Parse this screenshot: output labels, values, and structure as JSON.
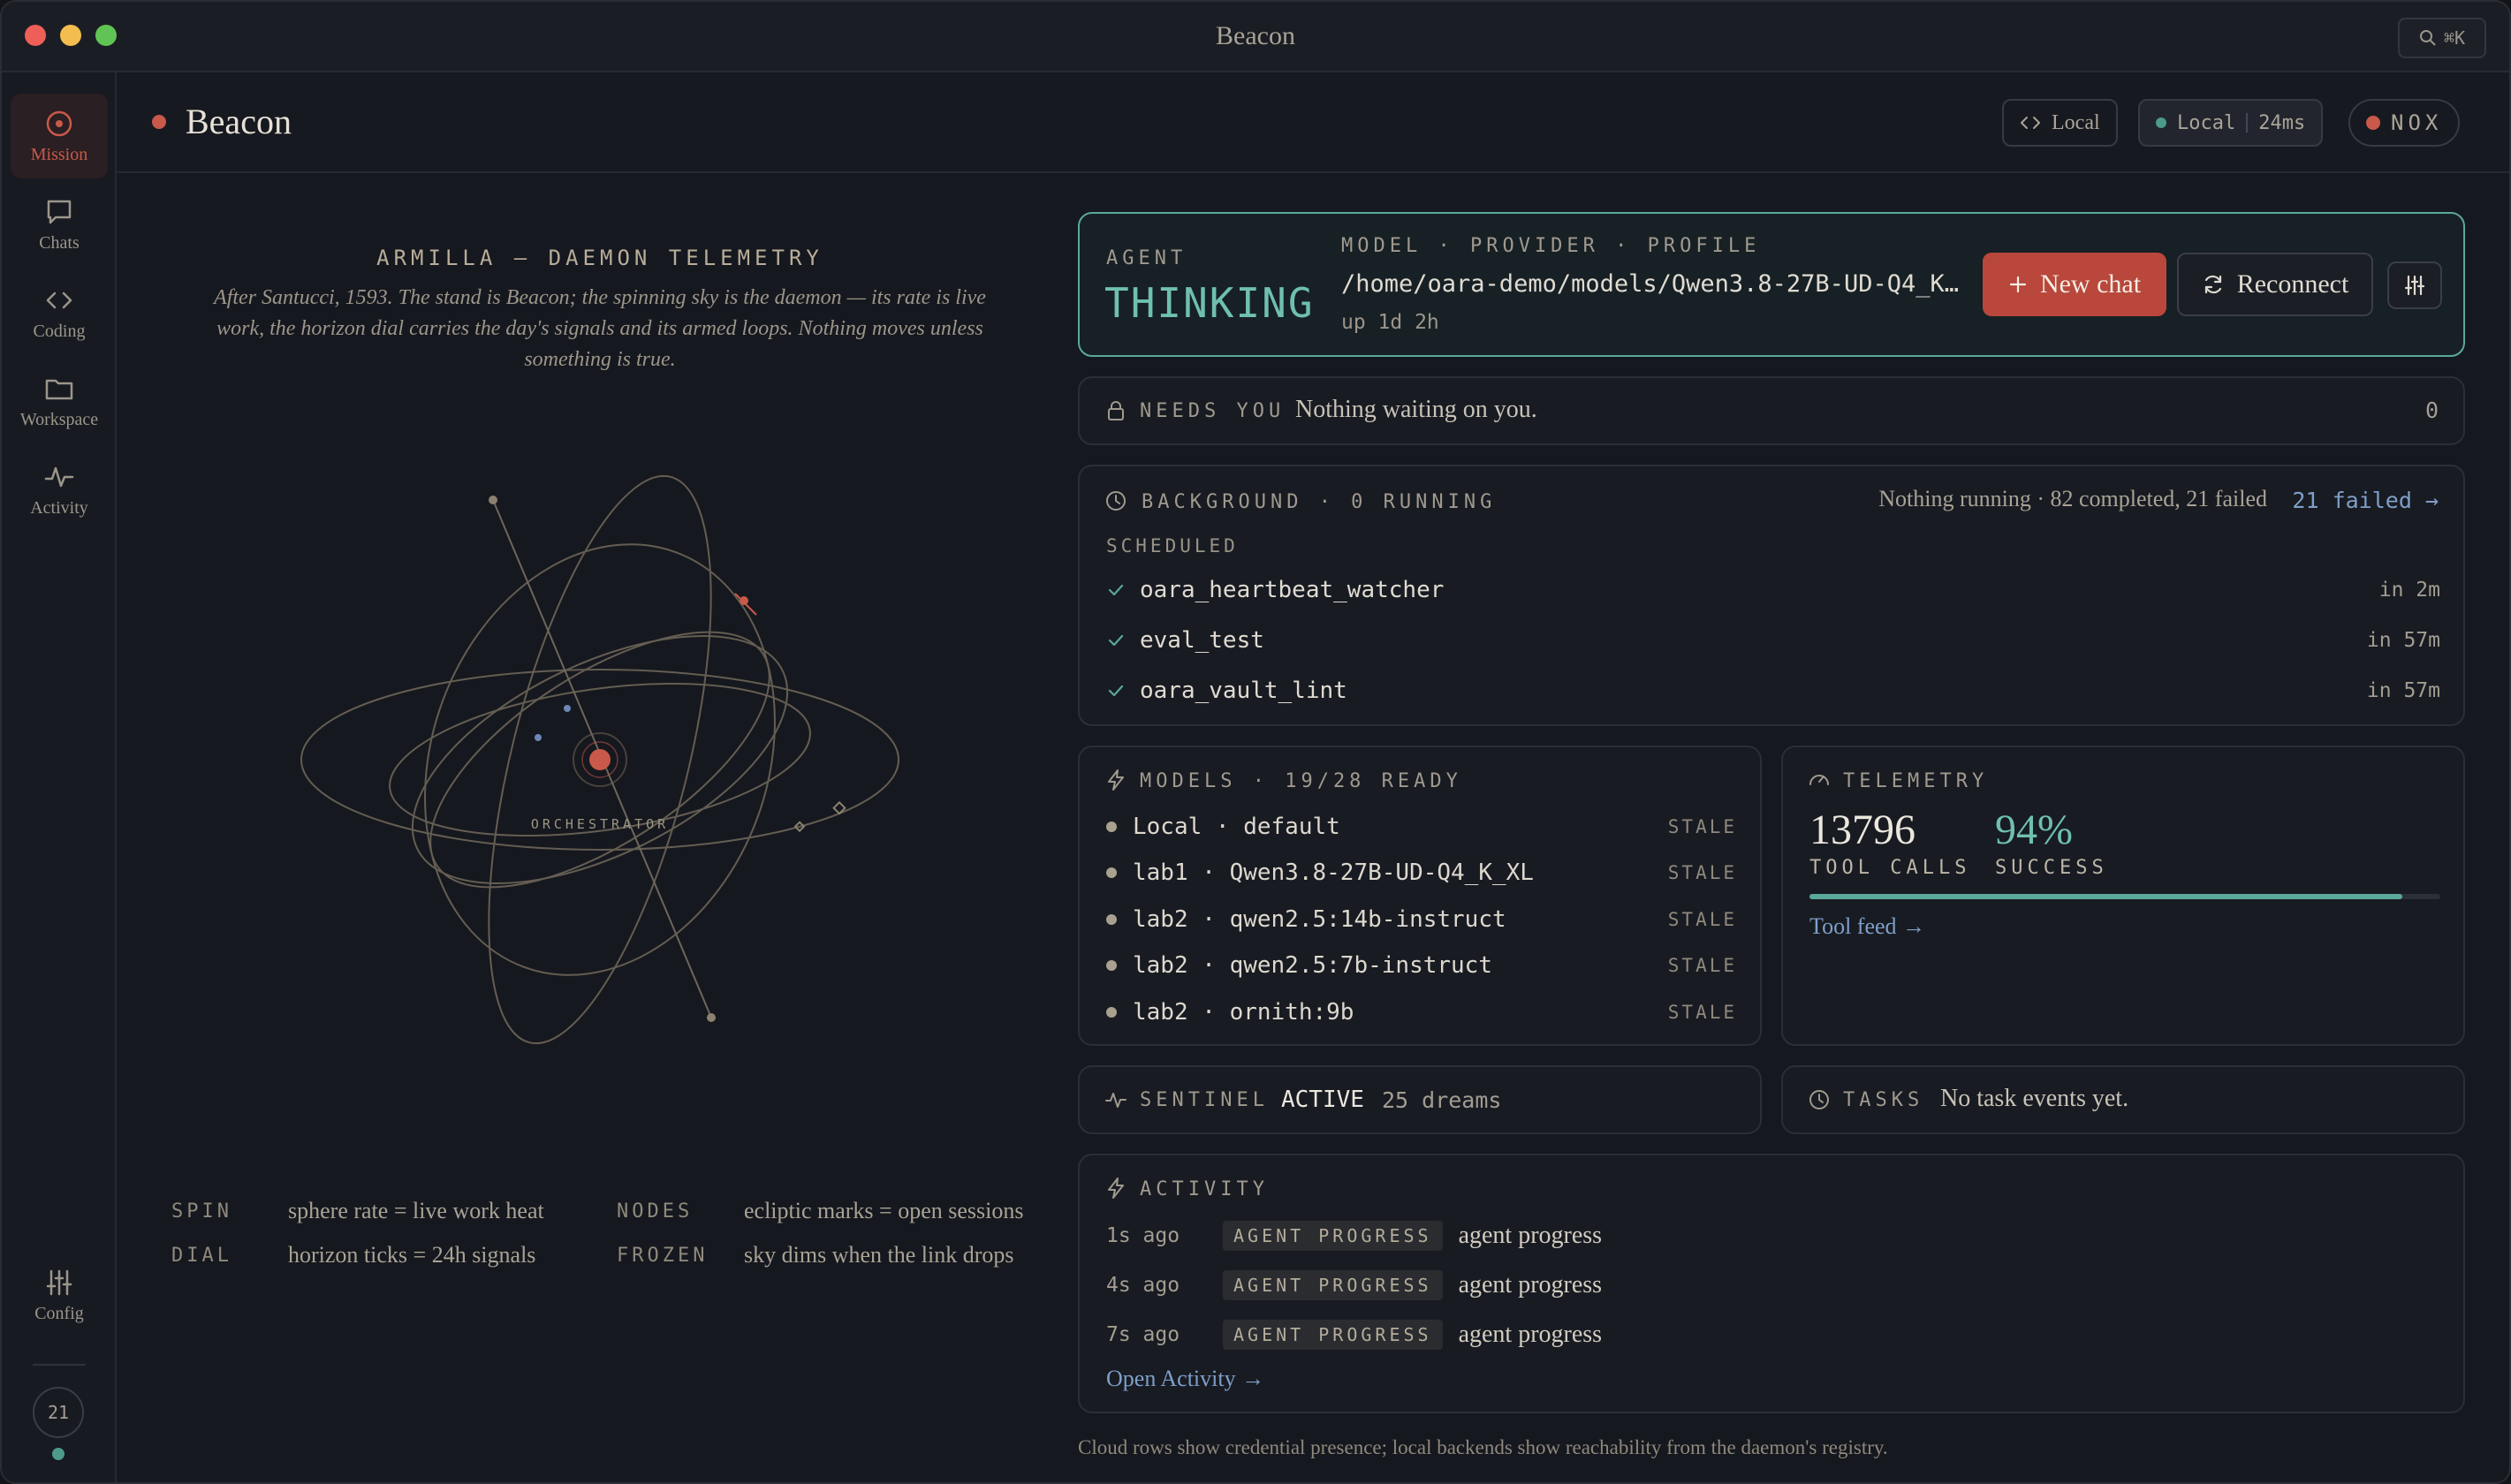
{
  "app": {
    "title": "Beacon",
    "search_shortcut": "⌘K"
  },
  "sidebar": {
    "items": [
      {
        "label": "Mission",
        "icon": "target-icon"
      },
      {
        "label": "Chats",
        "icon": "chat-bubble-icon"
      },
      {
        "label": "Coding",
        "icon": "code-brackets-icon"
      },
      {
        "label": "Workspace",
        "icon": "folder-icon"
      },
      {
        "label": "Activity",
        "icon": "pulse-icon"
      }
    ],
    "config_label": "Config",
    "count_badge": "21"
  },
  "header": {
    "title": "Beacon",
    "local_button": "Local",
    "connection": {
      "name": "Local",
      "latency": "24ms"
    },
    "nox_label": "NOX"
  },
  "telemetry_art": {
    "title": "ARMILLA — DAEMON TELEMETRY",
    "description": "After Santucci, 1593. The stand is Beacon; the spinning sky is the daemon — its rate is live work, the horizon dial carries the day's signals and its armed loops. Nothing moves unless something is true.",
    "center_label": "ORCHESTRATOR",
    "legend": [
      {
        "key": "SPIN",
        "value": "sphere rate = live work heat"
      },
      {
        "key": "NODES",
        "value": "ecliptic marks = open sessions"
      },
      {
        "key": "DIAL",
        "value": "horizon ticks = 24h signals"
      },
      {
        "key": "FROZEN",
        "value": "sky dims when the link drops"
      }
    ]
  },
  "agent": {
    "label": "AGENT",
    "state": "THINKING",
    "meta_label": "MODEL · PROVIDER · PROFILE",
    "model_path": "/home/oara-demo/models/Qwen3.8-27B-UD-Q4_K…",
    "uptime": "up 1d 2h",
    "new_chat": "New chat",
    "reconnect": "Reconnect"
  },
  "needs_you": {
    "label": "NEEDS YOU",
    "text": "Nothing waiting on you.",
    "count": "0"
  },
  "background": {
    "label": "BACKGROUND · 0 RUNNING",
    "summary": "Nothing running · 82 completed, 21 failed",
    "failed_link": "21 failed →",
    "scheduled_label": "SCHEDULED",
    "jobs": [
      {
        "name": "oara_heartbeat_watcher",
        "when": "in 2m"
      },
      {
        "name": "eval_test",
        "when": "in 57m"
      },
      {
        "name": "oara_vault_lint",
        "when": "in 57m"
      }
    ]
  },
  "models": {
    "label": "MODELS · 19/28 READY",
    "rows": [
      {
        "name": "Local · default",
        "status": "STALE"
      },
      {
        "name": "lab1 · Qwen3.8-27B-UD-Q4_K_XL",
        "status": "STALE"
      },
      {
        "name": "lab2 · qwen2.5:14b-instruct",
        "status": "STALE"
      },
      {
        "name": "lab2 · qwen2.5:7b-instruct",
        "status": "STALE"
      },
      {
        "name": "lab2 · ornith:9b",
        "status": "STALE"
      }
    ]
  },
  "telemetry": {
    "label": "TELEMETRY",
    "tool_calls": "13796",
    "tool_calls_label": "TOOL CALLS",
    "success": "94%",
    "success_label": "SUCCESS",
    "success_fraction": 0.94,
    "feed_link": "Tool feed →"
  },
  "sentinel": {
    "label": "SENTINEL",
    "state": "ACTIVE",
    "dreams": "25 dreams"
  },
  "tasks": {
    "label": "TASKS",
    "text": "No task events yet."
  },
  "activity": {
    "label": "ACTIVITY",
    "rows": [
      {
        "ago": "1s ago",
        "tag": "AGENT PROGRESS",
        "text": "agent progress"
      },
      {
        "ago": "4s ago",
        "tag": "AGENT PROGRESS",
        "text": "agent progress"
      },
      {
        "ago": "7s ago",
        "tag": "AGENT PROGRESS",
        "text": "agent progress"
      }
    ],
    "open_link": "Open Activity →"
  },
  "footnote": "Cloud rows show credential presence; local backends show reachability from the daemon's registry.",
  "colors": {
    "accent": "#c9594a",
    "teal": "#5aa89a",
    "link": "#7f9fc9"
  }
}
